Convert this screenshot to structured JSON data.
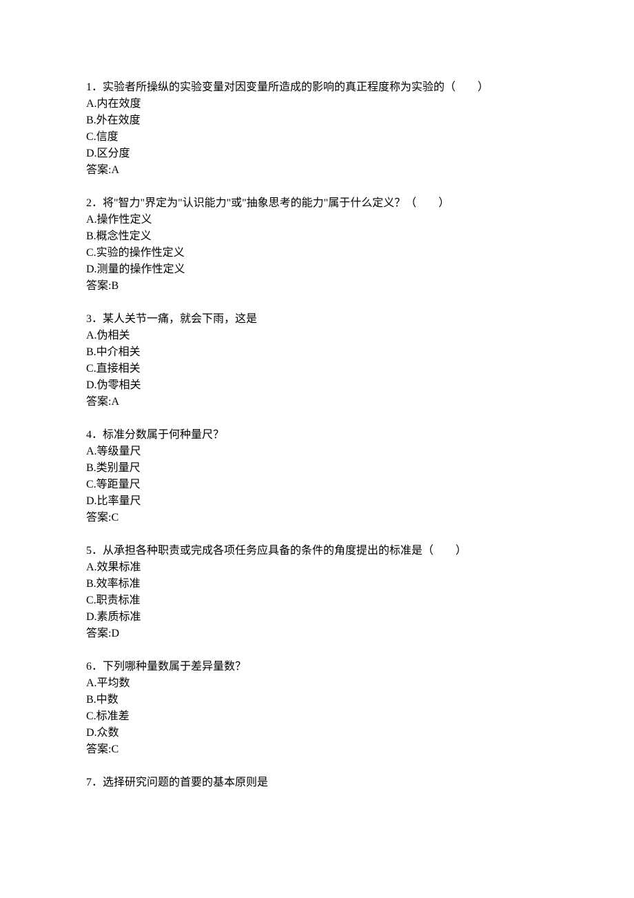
{
  "questions": [
    {
      "prompt": "1．实验者所操纵的实验变量对因变量所造成的影响的真正程度称为实验的（　　）",
      "options": [
        "A.内在效度",
        "B.外在效度",
        "C.信度",
        "D.区分度"
      ],
      "answer": "答案:A"
    },
    {
      "prompt": "2．将\"智力\"界定为\"认识能力\"或\"抽象思考的能力\"属于什么定义？（　　）",
      "options": [
        "A.操作性定义",
        "B.概念性定义",
        "C.实验的操作性定义",
        "D.测量的操作性定义"
      ],
      "answer": "答案:B"
    },
    {
      "prompt": "3．某人关节一痛，就会下雨，这是",
      "options": [
        "A.伪相关",
        "B.中介相关",
        "C.直接相关",
        "D.伪零相关"
      ],
      "answer": "答案:A"
    },
    {
      "prompt": "4．标准分数属于何种量尺？",
      "options": [
        "A.等级量尺",
        "B.类别量尺",
        "C.等距量尺",
        "D.比率量尺"
      ],
      "answer": "答案:C"
    },
    {
      "prompt": "5．从承担各种职责或完成各项任务应具备的条件的角度提出的标准是（　　）",
      "options": [
        "A.效果标准",
        "B.效率标准",
        "C.职责标准",
        "D.素质标准"
      ],
      "answer": "答案:D"
    },
    {
      "prompt": "6．下列哪种量数属于差异量数？",
      "options": [
        "A.平均数",
        "B.中数",
        "C.标准差",
        "D.众数"
      ],
      "answer": "答案:C"
    },
    {
      "prompt": "7．选择研究问题的首要的基本原则是",
      "options": [],
      "answer": null
    }
  ]
}
